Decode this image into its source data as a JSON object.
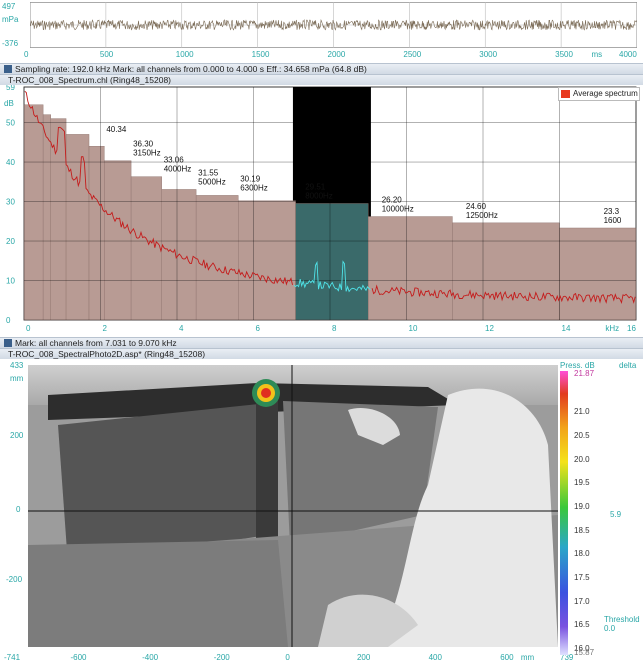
{
  "time_panel": {
    "ymax": "497",
    "unit": "mPa",
    "ymin": "-376",
    "x_ticks": [
      "0",
      "500",
      "1000",
      "1500",
      "2000",
      "2500",
      "3000",
      "3500",
      "4000"
    ],
    "x_unit": "ms"
  },
  "sampling_bar": "Sampling rate: 192.0 kHz Mark: all channels from 0.000 to 4.000 s Eff.: 34.658 mPa (64.8 dB)",
  "spectrum_title": "T-ROC_008_Spectrum.chl (Ring48_15208)",
  "mark_bar": "Mark: all channels from 7.031 to 9.070 kHz",
  "photo_title": "T-ROC_008_SpectralPhoto2D.asp* (Ring48_15208)",
  "chart_data": {
    "type": "bar",
    "ylabel": "dB",
    "xlabel": "kHz",
    "ylim": [
      0,
      59
    ],
    "xlim": [
      0,
      16
    ],
    "y_ticks": [
      "0",
      "10",
      "20",
      "30",
      "40",
      "50",
      "59"
    ],
    "x_ticks": [
      "0",
      "2",
      "4",
      "6",
      "8",
      "10",
      "12",
      "14",
      "16"
    ],
    "legend": "Average spectrum",
    "mark_band_khz": [
      7.031,
      9.07
    ],
    "series": [
      {
        "name": "Average spectrum",
        "bands": [
          {
            "x0": 0,
            "x1": 0.5,
            "v": 54.5
          },
          {
            "x0": 0.5,
            "x1": 0.7,
            "v": 52
          },
          {
            "x0": 0.7,
            "x1": 1.1,
            "v": 51
          },
          {
            "x0": 1.1,
            "x1": 1.7,
            "v": 47
          },
          {
            "x0": 1.7,
            "x1": 2.1,
            "v": 44
          },
          {
            "x0": 2.1,
            "x1": 2.8,
            "v": 40.34
          },
          {
            "x0": 2.8,
            "x1": 3.6,
            "v": 36.3
          },
          {
            "x0": 3.6,
            "x1": 4.5,
            "v": 33.06
          },
          {
            "x0": 4.5,
            "x1": 5.6,
            "v": 31.55
          },
          {
            "x0": 5.6,
            "x1": 7.1,
            "v": 30.19
          },
          {
            "x0": 7.1,
            "x1": 9.0,
            "v": 29.51
          },
          {
            "x0": 9.0,
            "x1": 11.2,
            "v": 26.2
          },
          {
            "x0": 11.2,
            "x1": 14.0,
            "v": 24.6
          },
          {
            "x0": 14.0,
            "x1": 16.0,
            "v": 23.3
          }
        ],
        "labels": [
          {
            "x": 2.1,
            "v": "40.34",
            "f": ""
          },
          {
            "x": 2.8,
            "v": "36.30",
            "f": "3150Hz"
          },
          {
            "x": 3.6,
            "v": "33.06",
            "f": "4000Hz"
          },
          {
            "x": 4.5,
            "v": "31.55",
            "f": "5000Hz"
          },
          {
            "x": 5.6,
            "v": "30.19",
            "f": "6300Hz"
          },
          {
            "x": 7.3,
            "v": "29.51",
            "f": "8000Hz"
          },
          {
            "x": 9.3,
            "v": "26.20",
            "f": "10000Hz"
          },
          {
            "x": 11.5,
            "v": "24.60",
            "f": "12500Hz"
          },
          {
            "x": 15.1,
            "v": "23.3",
            "f": "1600"
          }
        ]
      }
    ]
  },
  "photo_axes": {
    "y_top": "433",
    "y_unit": "mm",
    "y_ticks": [
      "200",
      "0",
      "-200"
    ],
    "x_ticks": [
      "-741",
      "-600",
      "-400",
      "-200",
      "0",
      "200",
      "400",
      "600",
      "739"
    ],
    "x_unit": "mm"
  },
  "colorbar": {
    "title": "Press. dB",
    "delta": "delta",
    "max": "21.87",
    "ticks": [
      "21.0",
      "20.5",
      "20.0",
      "19.5",
      "19.0",
      "18.5",
      "18.0",
      "17.5",
      "17.0",
      "16.5",
      "16.0"
    ],
    "min": "15.87",
    "delta_value": "5.9",
    "threshold_label": "Threshold",
    "threshold_value": "0.0"
  },
  "colors": {
    "band_fill": "#b89b94",
    "band_selected": "#3a6a6a",
    "spectrum_line": "#c41c1c",
    "accent": "#2aa7a7"
  }
}
